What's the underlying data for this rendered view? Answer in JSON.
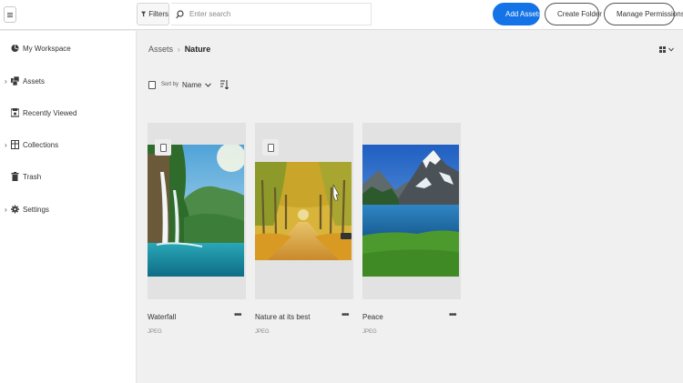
{
  "topbar": {
    "menu_icon": "hamburger-icon",
    "filters_label": "Filters",
    "search_placeholder": "Enter search",
    "add_assets_label": "Add Assets",
    "create_folder_label": "Create Folder",
    "manage_permissions_label": "Manage Permissions"
  },
  "sidebar": {
    "items": [
      {
        "label": "My Workspace",
        "icon": "workspace-icon",
        "expandable": false
      },
      {
        "label": "Assets",
        "icon": "assets-icon",
        "expandable": true
      },
      {
        "label": "Recently Viewed",
        "icon": "recent-icon",
        "expandable": false
      },
      {
        "label": "Collections",
        "icon": "collections-icon",
        "expandable": true
      },
      {
        "label": "Trash",
        "icon": "trash-icon",
        "expandable": false
      },
      {
        "label": "Settings",
        "icon": "settings-icon",
        "expandable": true
      }
    ]
  },
  "breadcrumb": {
    "root": "Assets",
    "separator": "›",
    "current": "Nature"
  },
  "sortbar": {
    "label": "Sort by",
    "value": "Name"
  },
  "cards": [
    {
      "title": "Waterfall",
      "type": "JPEG",
      "more": "•••"
    },
    {
      "title": "Nature at its best",
      "type": "JPEG",
      "more": "•••"
    },
    {
      "title": "Peace",
      "type": "JPEG",
      "more": "•••"
    }
  ],
  "colors": {
    "accent": "#1473e6",
    "background": "#f0f0f0",
    "sidebar": "#ffffff"
  }
}
